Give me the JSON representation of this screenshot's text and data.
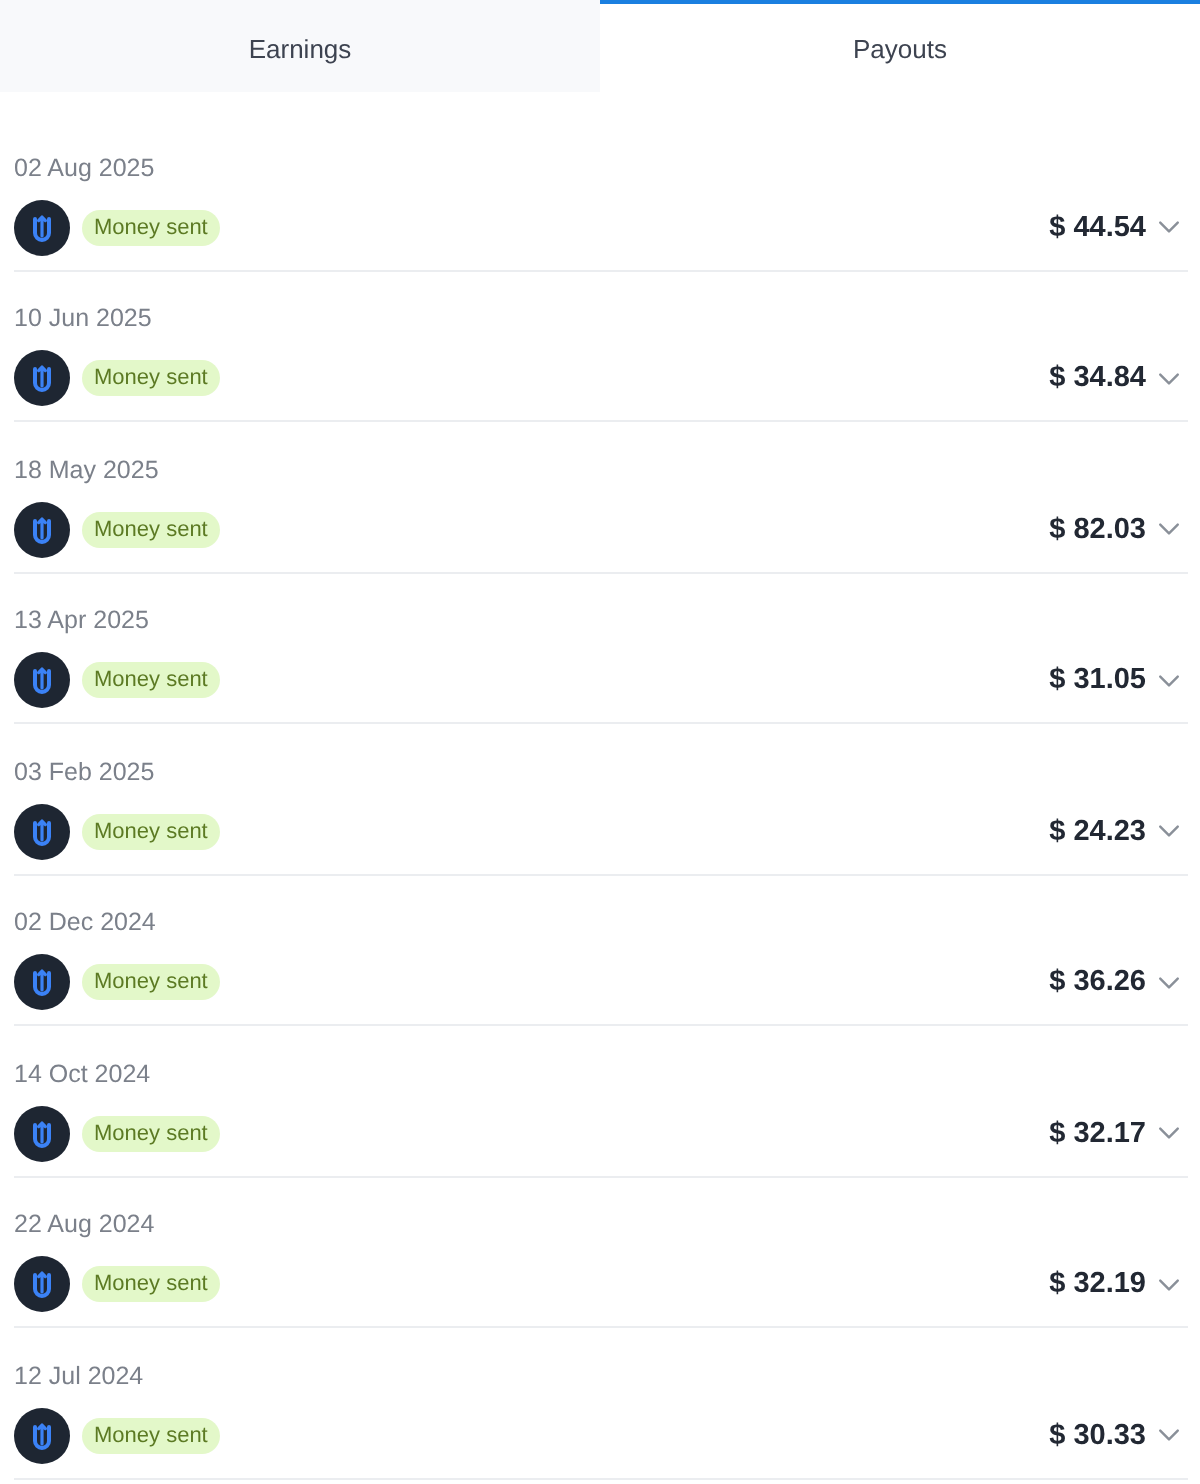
{
  "tabs": [
    {
      "label": "Earnings",
      "selected": false
    },
    {
      "label": "Payouts",
      "selected": true
    }
  ],
  "payouts": [
    {
      "date": "02 Aug 2025",
      "status": "Money sent",
      "amount": "$ 44.54",
      "expanded": false
    },
    {
      "date": "10 Jun 2025",
      "status": "Money sent",
      "amount": "$ 34.84",
      "expanded": false
    },
    {
      "date": "18 May 2025",
      "status": "Money sent",
      "amount": "$ 82.03",
      "expanded": false
    },
    {
      "date": "13 Apr 2025",
      "status": "Money sent",
      "amount": "$ 31.05",
      "expanded": false
    },
    {
      "date": "03 Feb 2025",
      "status": "Money sent",
      "amount": "$ 24.23",
      "expanded": false
    },
    {
      "date": "02 Dec 2024",
      "status": "Money sent",
      "amount": "$ 36.26",
      "expanded": false
    },
    {
      "date": "14 Oct 2024",
      "status": "Money sent",
      "amount": "$ 32.17",
      "expanded": false
    },
    {
      "date": "22 Aug 2024",
      "status": "Money sent",
      "amount": "$ 32.19",
      "expanded": false
    },
    {
      "date": "12 Jul 2024",
      "status": "Money sent",
      "amount": "$ 30.33",
      "expanded": false
    }
  ]
}
